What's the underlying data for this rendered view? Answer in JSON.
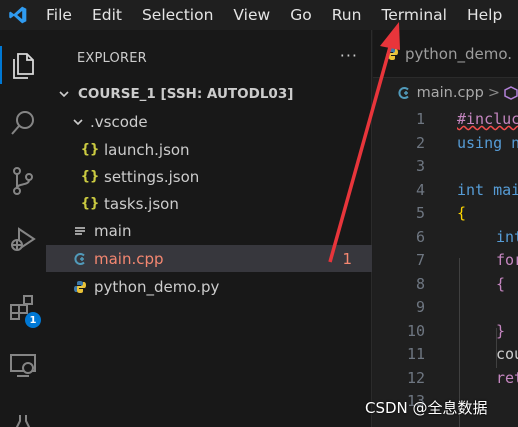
{
  "menu": [
    "File",
    "Edit",
    "Selection",
    "View",
    "Go",
    "Run",
    "Terminal",
    "Help"
  ],
  "activity": {
    "icons": [
      "files-icon",
      "search-icon",
      "source-control-icon",
      "run-debug-icon",
      "extensions-icon",
      "remote-explorer-icon",
      "testing-icon"
    ],
    "extensions_badge": "1"
  },
  "sidebar": {
    "title": "EXPLORER",
    "more": "···",
    "root": "COURSE_1 [SSH: AUTODL03]",
    "vscode_folder": ".vscode",
    "files": [
      {
        "name": "launch.json",
        "icon": "{}"
      },
      {
        "name": "settings.json",
        "icon": "{}"
      },
      {
        "name": "tasks.json",
        "icon": "{}"
      }
    ],
    "main_file": "main",
    "main_cpp": "main.cpp",
    "main_cpp_problems": "1",
    "python_file": "python_demo.py"
  },
  "editor": {
    "tab_label": "python_demo.",
    "breadcrumb_file": "main.cpp",
    "breadcrumb_sep": ">",
    "lines": [
      {
        "n": "1",
        "text": "#incluc"
      },
      {
        "n": "2",
        "text": "using n"
      },
      {
        "n": "3",
        "text": ""
      },
      {
        "n": "4",
        "text": "int mai"
      },
      {
        "n": "5",
        "text": "{"
      },
      {
        "n": "6",
        "text": "int"
      },
      {
        "n": "7",
        "text": "for"
      },
      {
        "n": "8",
        "text": "{"
      },
      {
        "n": "9",
        "text": ""
      },
      {
        "n": "10",
        "text": "}"
      },
      {
        "n": "11",
        "text": "cou"
      },
      {
        "n": "12",
        "text": "ret"
      },
      {
        "n": "13",
        "text": ""
      }
    ]
  },
  "watermark": "CSDN @全息数据",
  "colors": {
    "accent": "#0078d4",
    "error": "#f48771",
    "arrow": "#e8353b"
  }
}
